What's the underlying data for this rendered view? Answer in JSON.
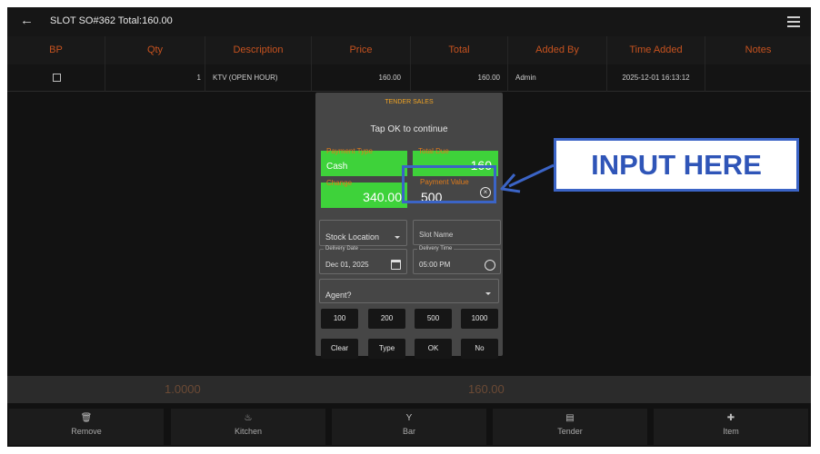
{
  "header": {
    "title": "SLOT SO#362 Total:160.00",
    "back_icon": "back-arrow-icon",
    "menu_icon": "hamburger-menu-icon"
  },
  "table": {
    "columns": [
      "BP",
      "Qty",
      "Description",
      "Price",
      "Total",
      "Added By",
      "Time Added",
      "Notes"
    ],
    "rows": [
      {
        "bp_checked": false,
        "qty": "1",
        "description": "KTV (OPEN HOUR)",
        "price": "160.00",
        "total": "160.00",
        "added_by": "Admin",
        "time_added": "2025-12-01 16:13:12",
        "notes": ""
      }
    ]
  },
  "dialog": {
    "title": "TENDER SALES",
    "subtitle": "Tap OK to continue",
    "payment_type": {
      "label": "Payment Type",
      "value": "Cash"
    },
    "total_due": {
      "label": "Total Due",
      "value": "160"
    },
    "change": {
      "label": "Change",
      "value": "340.00"
    },
    "payment_value": {
      "label": "Payment Value",
      "value": "500"
    },
    "stock_location": {
      "placeholder": "Stock Location"
    },
    "slot_name": {
      "placeholder": "Slot Name"
    },
    "delivery_date": {
      "label": "Delivery Date",
      "value": "Dec 01, 2025"
    },
    "delivery_time": {
      "label": "Delivery Time",
      "value": "05:00 PM"
    },
    "agent": {
      "placeholder": "Agent?"
    },
    "quick_amounts": [
      "100",
      "200",
      "500",
      "1000"
    ],
    "actions": [
      "Clear",
      "Type",
      "OK",
      "No"
    ]
  },
  "annotation": {
    "callout_text": "INPUT HERE",
    "color": "#3b64c6"
  },
  "summary": {
    "qty_total": "1.0000",
    "amount_total": "160.00"
  },
  "bottom_bar": [
    {
      "label": "Remove",
      "icon": "trash-icon"
    },
    {
      "label": "Kitchen",
      "icon": "chef-hat-icon"
    },
    {
      "label": "Bar",
      "icon": "cocktail-glass-icon"
    },
    {
      "label": "Tender",
      "icon": "cash-register-icon"
    },
    {
      "label": "Item",
      "icon": "plus-icon"
    }
  ]
}
